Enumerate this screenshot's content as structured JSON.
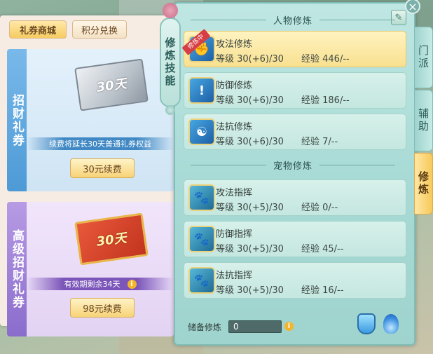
{
  "shop": {
    "tabs": [
      "礼券商城",
      "积分兑换"
    ],
    "cards": [
      {
        "title": "招财礼券",
        "ticket_text": "30天",
        "note": "续费将延长30天普通礼券权益",
        "button": "30元续费"
      },
      {
        "title": "高级招财礼券",
        "ticket_text": "30天",
        "note": "有效期剩余34天",
        "button": "98元续费"
      }
    ]
  },
  "panel": {
    "title": "修炼技能",
    "character_section": "人物修炼",
    "pet_section": "宠物修炼",
    "active_badge": "修炼中",
    "character_skills": [
      {
        "name": "攻法修炼",
        "level": "等级 30(+6)/30",
        "exp": "经验 446/--"
      },
      {
        "name": "防御修炼",
        "level": "等级 30(+6)/30",
        "exp": "经验 186/--"
      },
      {
        "name": "法抗修炼",
        "level": "等级 30(+6)/30",
        "exp": "经验 7/--"
      }
    ],
    "pet_skills": [
      {
        "name": "攻法指挥",
        "level": "等级 30(+5)/30",
        "exp": "经验 0/--"
      },
      {
        "name": "防御指挥",
        "level": "等级 30(+5)/30",
        "exp": "经验 45/--"
      },
      {
        "name": "法抗指挥",
        "level": "等级 30(+5)/30",
        "exp": "经验 16/--"
      }
    ],
    "reserve_label": "储备修炼",
    "reserve_value": "0"
  },
  "side_tabs": [
    "门派",
    "辅助",
    "修炼"
  ],
  "icons": [
    "gift-ticket-icon",
    "edit-icon",
    "close-icon",
    "potion-icon",
    "flame-icon"
  ]
}
